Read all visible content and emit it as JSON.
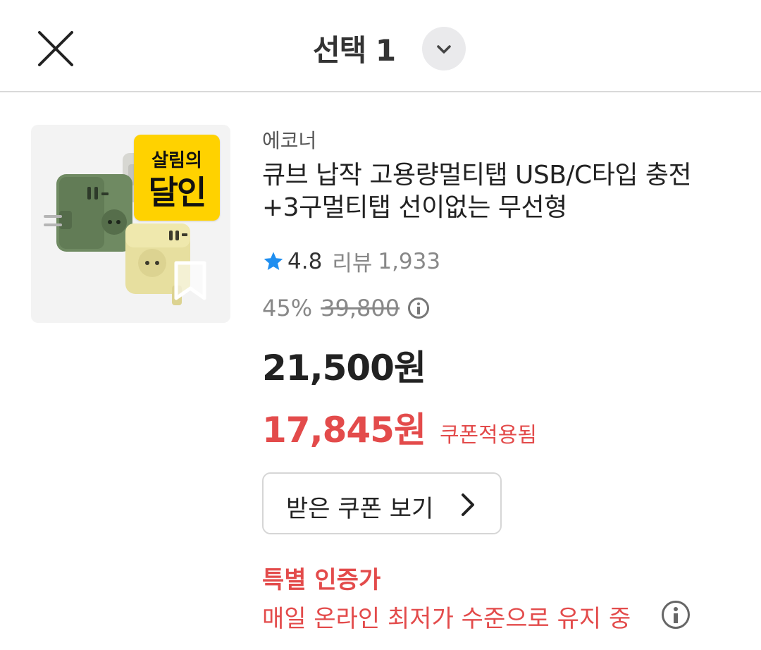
{
  "header": {
    "title": "선택 1",
    "close_icon": "close-icon",
    "dropdown_icon": "chevron-down-icon"
  },
  "product": {
    "badge_line1": "살림의",
    "badge_line2": "달인",
    "brand": "에코너",
    "title": "큐브 납작 고용량멀티탭 USB/C타입 충전+3구멀티탭 선이없는 무선형",
    "rating": "4.8",
    "review_label": "리뷰",
    "review_count": "1,933",
    "discount": "45%",
    "original_price": "39,800",
    "price": "21,500원",
    "coupon_price": "17,845원",
    "coupon_applied_label": "쿠폰적용됨",
    "coupon_button_label": "받은 쿠폰 보기",
    "promo_title": "특별 인증가",
    "promo_desc": "매일 온라인 최저가 수준으로 유지 중"
  },
  "colors": {
    "accent_red": "#e34b4b",
    "star_blue": "#1e8ef0",
    "badge_yellow": "#ffd200"
  }
}
